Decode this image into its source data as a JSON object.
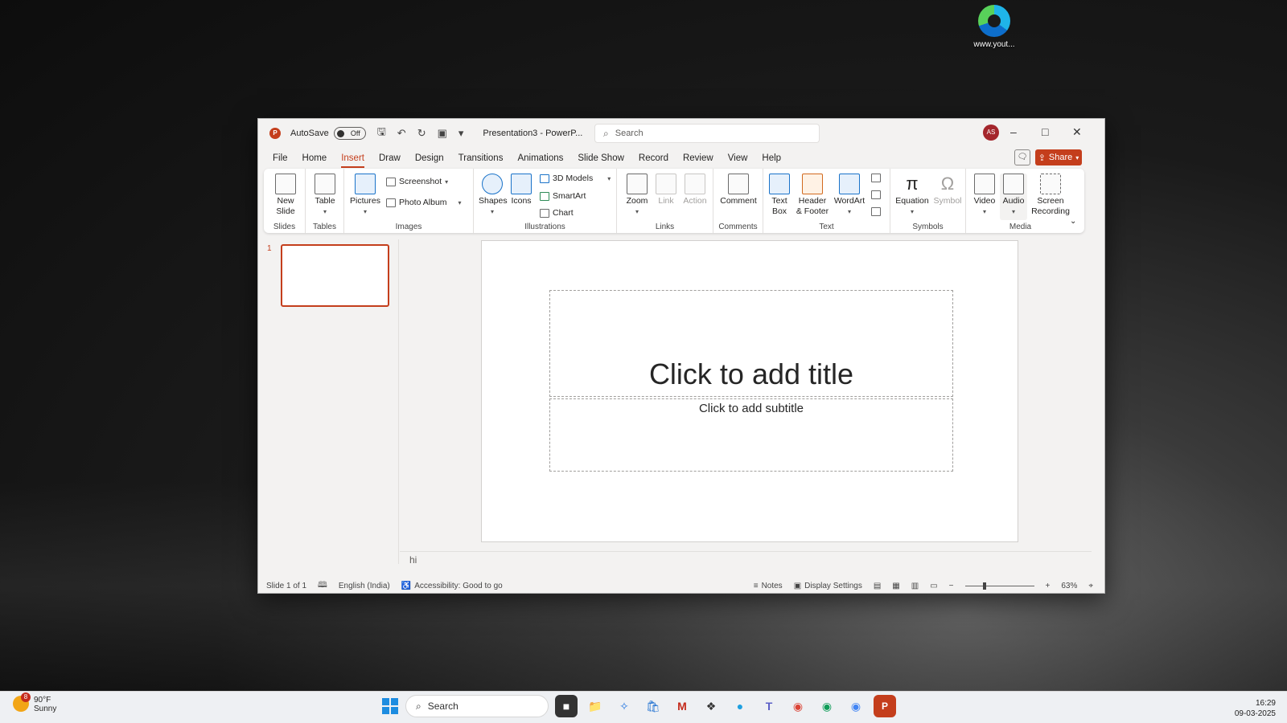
{
  "desktop": {
    "icon_label": "www.yout..."
  },
  "window": {
    "autosave_label": "AutoSave",
    "autosave_state": "Off",
    "doc_title": "Presentation3  -  PowerP...",
    "search_placeholder": "Search",
    "avatar_initials": "AS",
    "share_label": "Share"
  },
  "tabs": [
    "File",
    "Home",
    "Insert",
    "Draw",
    "Design",
    "Transitions",
    "Animations",
    "Slide Show",
    "Record",
    "Review",
    "View",
    "Help"
  ],
  "active_tab": "Insert",
  "ribbon": {
    "groups": {
      "slides": "Slides",
      "tables": "Tables",
      "images": "Images",
      "illustrations": "Illustrations",
      "links": "Links",
      "comments": "Comments",
      "text": "Text",
      "symbols": "Symbols",
      "media": "Media"
    },
    "buttons": {
      "new_slide_1": "New",
      "new_slide_2": "Slide",
      "table": "Table",
      "pictures": "Pictures",
      "screenshot": "Screenshot",
      "photo_album": "Photo Album",
      "shapes": "Shapes",
      "icons": "Icons",
      "models_3d": "3D Models",
      "smartart": "SmartArt",
      "chart": "Chart",
      "zoom": "Zoom",
      "link": "Link",
      "action": "Action",
      "comment": "Comment",
      "text_box_1": "Text",
      "text_box_2": "Box",
      "header_footer_1": "Header",
      "header_footer_2": "& Footer",
      "wordart": "WordArt",
      "equation": "Equation",
      "symbol": "Symbol",
      "video": "Video",
      "audio": "Audio",
      "screen_recording_1": "Screen",
      "screen_recording_2": "Recording"
    }
  },
  "thumbnails": {
    "slide_number": "1"
  },
  "slide": {
    "title_placeholder": "Click to add title",
    "subtitle_placeholder": "Click to add subtitle"
  },
  "notes_text": "hi",
  "statusbar": {
    "slide_of": "Slide 1 of 1",
    "language": "English (India)",
    "accessibility": "Accessibility: Good to go",
    "notes": "Notes",
    "display_settings": "Display Settings",
    "zoom_level": "63%"
  },
  "taskbar": {
    "temp": "90°F",
    "weather": "Sunny",
    "weather_badge": "8",
    "search_label": "Search",
    "time": "16:29",
    "date": "09-03-2025"
  }
}
